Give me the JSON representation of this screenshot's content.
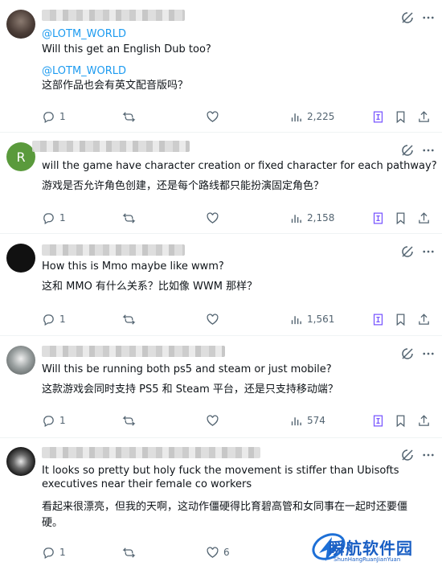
{
  "posts": [
    {
      "handle": "@LOTM_WORLD",
      "text_en": "Will this get an English Dub too?",
      "quote_handle": "@LOTM_WORLD",
      "text_zh": "这部作品也会有英文配音版吗？",
      "replies": "1",
      "views": "2,225"
    },
    {
      "avatar_letter": "R",
      "text_en": "will the game have character creation or fixed character for each pathway?",
      "text_zh": "游戏是否允许角色创建，还是每个路线都只能扮演固定角色？",
      "replies": "1",
      "views": "2,158"
    },
    {
      "text_en": "How this is Mmo maybe like wwm?",
      "text_zh": "这和 MMO 有什么关系？比如像 WWM 那样？",
      "replies": "1",
      "views": "1,561"
    },
    {
      "text_en": "Will this be running both ps5 and steam or just mobile?",
      "text_zh": "这款游戏会同时支持 PS5 和 Steam 平台，还是只支持移动端？",
      "replies": "1",
      "views": "574"
    },
    {
      "text_en": "It looks so pretty but holy fuck the movement is stiffer than Ubisofts executives near their female co workers",
      "text_zh": "看起来很漂亮，但我的天啊，这动作僵硬得比育碧高管和女同事在一起时还要僵硬。",
      "replies": "1",
      "likes": "6"
    }
  ],
  "watermark": {
    "main": "瞬航软件园",
    "sub": "ShunHangRuanJianYuan"
  },
  "colors": {
    "text": "#0f1419",
    "secondary": "#536471",
    "link": "#1d9bf0",
    "grok_purple": "#7856ff",
    "avatar_green": "#5a9a3c"
  }
}
